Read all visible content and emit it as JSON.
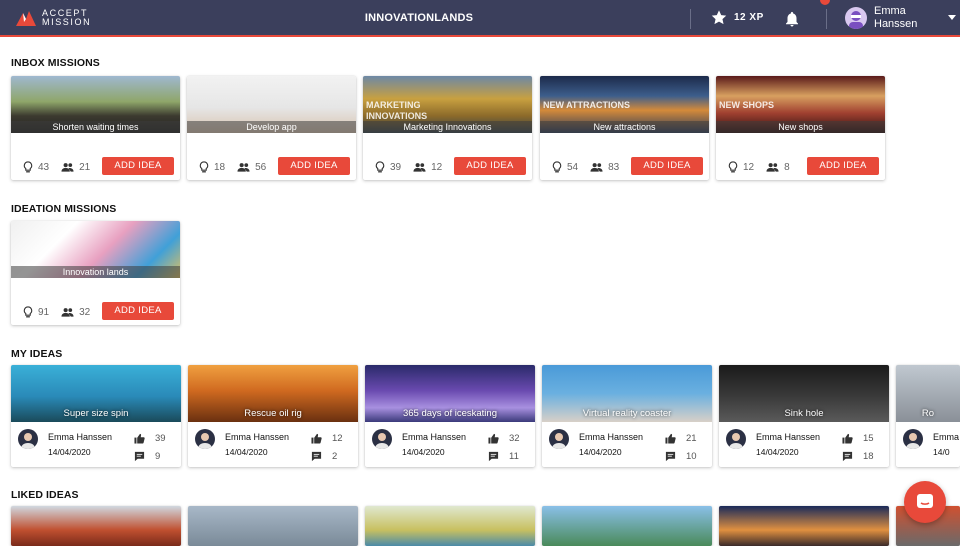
{
  "header": {
    "logo_line1": "ACCEPT",
    "logo_line2": "MISSION",
    "title": "INNOVATIONLANDS",
    "xp": "12 XP",
    "user_first": "Emma",
    "user_last": "Hanssen"
  },
  "colors": {
    "topbar": "#3b3f5c",
    "accent": "#e8493a"
  },
  "sections": {
    "inbox": "INBOX MISSIONS",
    "ideation": "IDEATION MISSIONS",
    "my_ideas": "MY IDEAS",
    "liked": "LIKED IDEAS"
  },
  "add_label": "ADD IDEA",
  "inbox_missions": [
    {
      "title": "Shorten waiting times",
      "ideas": "43",
      "people": "21",
      "overlay": ""
    },
    {
      "title": "Develop app",
      "ideas": "18",
      "people": "56",
      "overlay": ""
    },
    {
      "title": "Marketing Innovations",
      "ideas": "39",
      "people": "12",
      "overlay": "MARKETING INNOVATIONS"
    },
    {
      "title": "New attractions",
      "ideas": "54",
      "people": "83",
      "overlay": "NEW ATTRACTIONS"
    },
    {
      "title": "New shops",
      "ideas": "12",
      "people": "8",
      "overlay": "NEW SHOPS"
    }
  ],
  "ideation_missions": [
    {
      "title": "Innovation lands",
      "ideas": "91",
      "people": "32"
    }
  ],
  "my_ideas": [
    {
      "title": "Super size spin",
      "author": "Emma Hanssen",
      "date": "14/04/2020",
      "likes": "39",
      "comments": "9"
    },
    {
      "title": "Rescue oil rig",
      "author": "Emma Hanssen",
      "date": "14/04/2020",
      "likes": "12",
      "comments": "2"
    },
    {
      "title": "365 days of iceskating",
      "author": "Emma Hanssen",
      "date": "14/04/2020",
      "likes": "32",
      "comments": "11"
    },
    {
      "title": "Virtual reality coaster",
      "author": "Emma Hanssen",
      "date": "14/04/2020",
      "likes": "21",
      "comments": "10"
    },
    {
      "title": "Sink hole",
      "author": "Emma Hanssen",
      "date": "14/04/2020",
      "likes": "15",
      "comments": "18"
    },
    {
      "title": "Ro",
      "author": "Emma",
      "date": "14/0",
      "likes": "",
      "comments": ""
    }
  ],
  "icons": {
    "ideas": "lightbulb-icon",
    "people": "people-icon",
    "like": "thumb-up-icon",
    "comment": "comment-icon",
    "xp": "star-icon",
    "notifications": "bell-icon",
    "chat": "chat-icon"
  }
}
